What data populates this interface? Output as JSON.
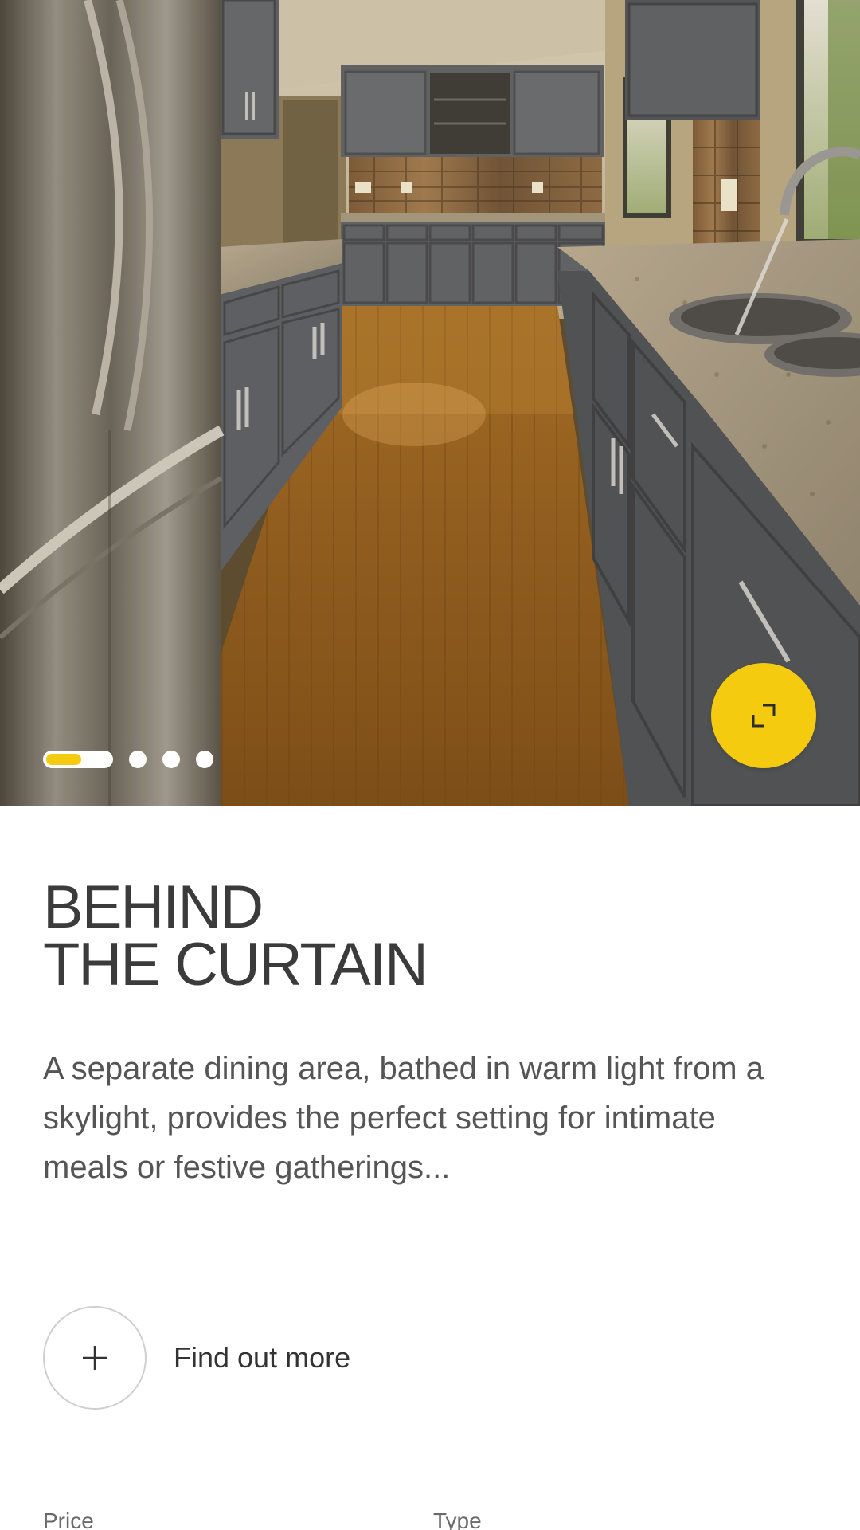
{
  "gallery": {
    "slide_count": 4,
    "active_index": 0,
    "active_progress": 0.5
  },
  "expand_button": {
    "icon": "expand-icon",
    "color": "#f5cb10"
  },
  "content": {
    "title_line1": "BEHIND",
    "title_line2": "THE CURTAIN",
    "description": "A separate dining area, bathed in warm light from a skylight, provides the perfect setting for intimate meals or festive gatherings...",
    "cta_label": "Find out more",
    "cta_icon": "plus-icon"
  },
  "details": {
    "price_label": "Price",
    "type_label": "Type"
  },
  "colors": {
    "accent": "#f5cb10",
    "text_dark": "#3b3b3b",
    "text_body": "#555555"
  }
}
